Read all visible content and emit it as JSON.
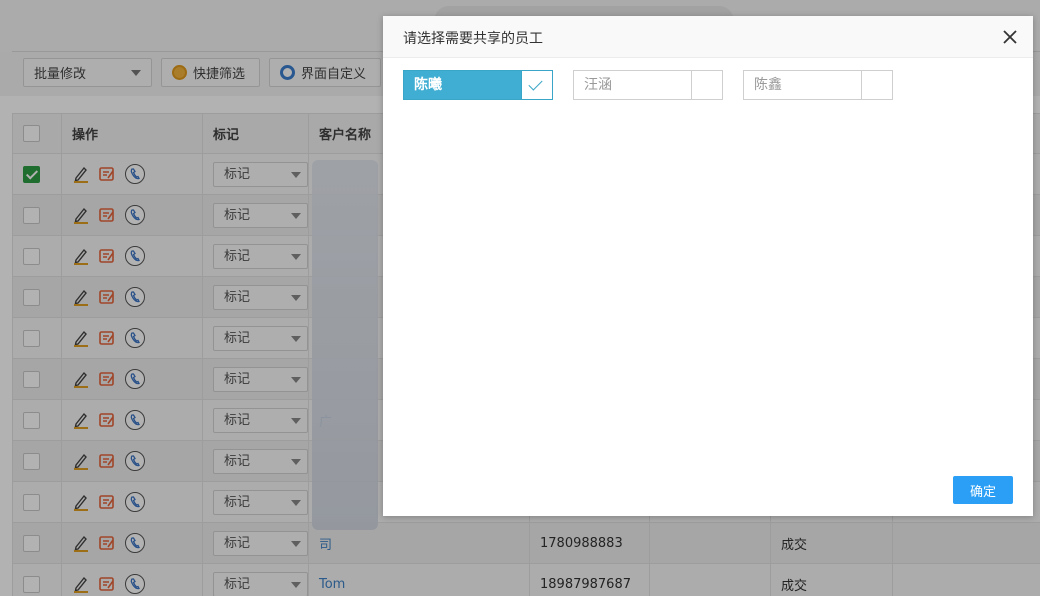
{
  "app": {
    "top_text": "",
    "toolbar": {
      "bulk_edit_label": "批量修改",
      "quick_filter_label": "快捷筛选",
      "customize_ui_label": "界面自定义"
    },
    "table": {
      "headers": [
        "操作",
        "标记",
        "客户名称"
      ],
      "mark_placeholder": "标记",
      "rows": [
        {
          "checked": true,
          "customer": "",
          "phone": "",
          "status": ""
        },
        {
          "checked": false,
          "customer": "",
          "phone": "",
          "status": ""
        },
        {
          "checked": false,
          "customer": "",
          "phone": "",
          "status": ""
        },
        {
          "checked": false,
          "customer": "",
          "phone": "",
          "status": ""
        },
        {
          "checked": false,
          "customer": "",
          "phone": "",
          "status": ""
        },
        {
          "checked": false,
          "customer": "",
          "phone": "",
          "status": ""
        },
        {
          "checked": false,
          "customer": "广",
          "phone": "",
          "status": ""
        },
        {
          "checked": false,
          "customer": "",
          "phone": "",
          "status": ""
        },
        {
          "checked": false,
          "customer": "",
          "phone": "",
          "status": ""
        },
        {
          "checked": false,
          "customer": "司",
          "phone": "1780988883",
          "status": "成交"
        },
        {
          "checked": false,
          "customer": "Tom",
          "phone": "18987987687",
          "status": "成交"
        }
      ]
    }
  },
  "modal": {
    "title": "请选择需要共享的员工",
    "employees": [
      {
        "name": "陈曦",
        "selected": true
      },
      {
        "name": "汪涵",
        "selected": false
      },
      {
        "name": "陈鑫",
        "selected": false
      }
    ],
    "confirm_label": "确定"
  },
  "colors": {
    "accent": "#2a9ff5",
    "selected_employee": "#40aed3",
    "checkbox_checked": "#2e9c46",
    "link": "#3f83c7"
  }
}
